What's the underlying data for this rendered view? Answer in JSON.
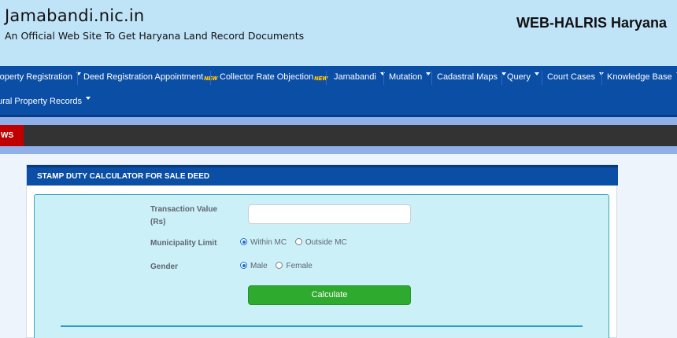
{
  "header": {
    "site_title": "Jamabandi.nic.in",
    "site_subtitle": "An Official Web Site To Get Haryana Land Record Documents",
    "brand": "WEB-HALRIS Haryana",
    "bg_color": "#bfe3f7"
  },
  "nav": {
    "bg_color": "#0a4ea6",
    "items": [
      {
        "label": "roperty Registration",
        "caret": true
      },
      {
        "label": "Deed Registration Appointment",
        "badge": "NEW"
      },
      {
        "label": "Collector Rate Objection",
        "badge": "NEW"
      },
      {
        "label": "Jamabandi",
        "caret": true
      },
      {
        "label": "Mutation",
        "caret": true
      },
      {
        "label": "Cadastral Maps",
        "caret": true
      },
      {
        "label": "Query",
        "caret": true
      },
      {
        "label": "Court Cases",
        "caret": true
      },
      {
        "label": "Knowledge Base",
        "caret": true
      },
      {
        "label": "ural Property Records",
        "caret": true
      }
    ]
  },
  "news": {
    "tag": "WS",
    "tag_color": "#c00000"
  },
  "calculator": {
    "title": "STAMP DUTY CALCULATOR FOR SALE DEED",
    "transaction_label_1": "Transaction Value",
    "transaction_label_2": "(Rs)",
    "transaction_value": "",
    "municipality_label": "Municipality Limit",
    "municipality_options": [
      "Within MC",
      "Outside MC"
    ],
    "municipality_selected": "Within MC",
    "gender_label": "Gender",
    "gender_options": [
      "Male",
      "Female"
    ],
    "gender_selected": "Male",
    "calculate_label": "Calculate",
    "button_color": "#2eaa2e"
  }
}
